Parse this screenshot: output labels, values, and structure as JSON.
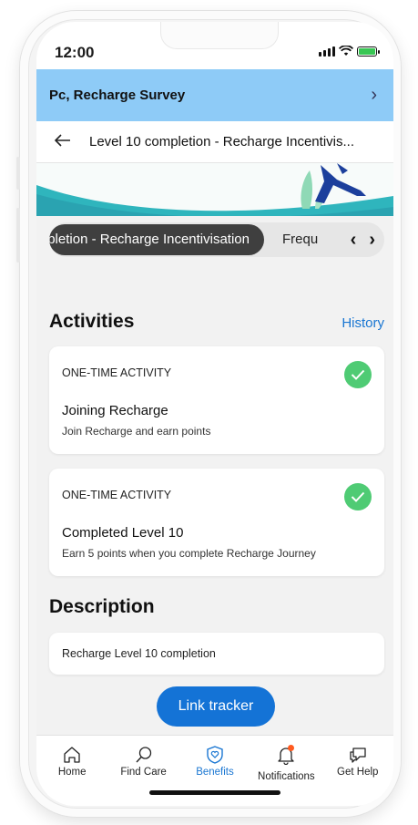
{
  "status_bar": {
    "time": "12:00"
  },
  "survey_bar": {
    "title": "Pc, Recharge Survey"
  },
  "nav": {
    "title": "Level 10 completion - Recharge Incentivis..."
  },
  "chips": {
    "active": "pletion - Recharge Incentivisation",
    "next": "Frequ"
  },
  "activities": {
    "title": "Activities",
    "history_label": "History",
    "items": [
      {
        "type": "ONE-TIME ACTIVITY",
        "title": "Joining Recharge",
        "subtitle": "Join Recharge and earn points"
      },
      {
        "type": "ONE-TIME ACTIVITY",
        "title": "Completed Level 10",
        "subtitle": "Earn 5 points when you complete Recharge Journey"
      }
    ]
  },
  "description": {
    "title": "Description",
    "text": "Recharge Level 10 completion"
  },
  "link_tracker": {
    "label": "Link tracker"
  },
  "tabs": [
    {
      "label": "Home",
      "icon": "home-icon"
    },
    {
      "label": "Find Care",
      "icon": "search-icon"
    },
    {
      "label": "Benefits",
      "icon": "shield-heart-icon"
    },
    {
      "label": "Notifications",
      "icon": "bell-icon"
    },
    {
      "label": "Get Help",
      "icon": "chat-icon"
    }
  ],
  "colors": {
    "accent": "#1473d6",
    "survey_bar": "#8ecbf7",
    "check": "#4fcb74",
    "banner_teal": "#2fb5bd"
  }
}
